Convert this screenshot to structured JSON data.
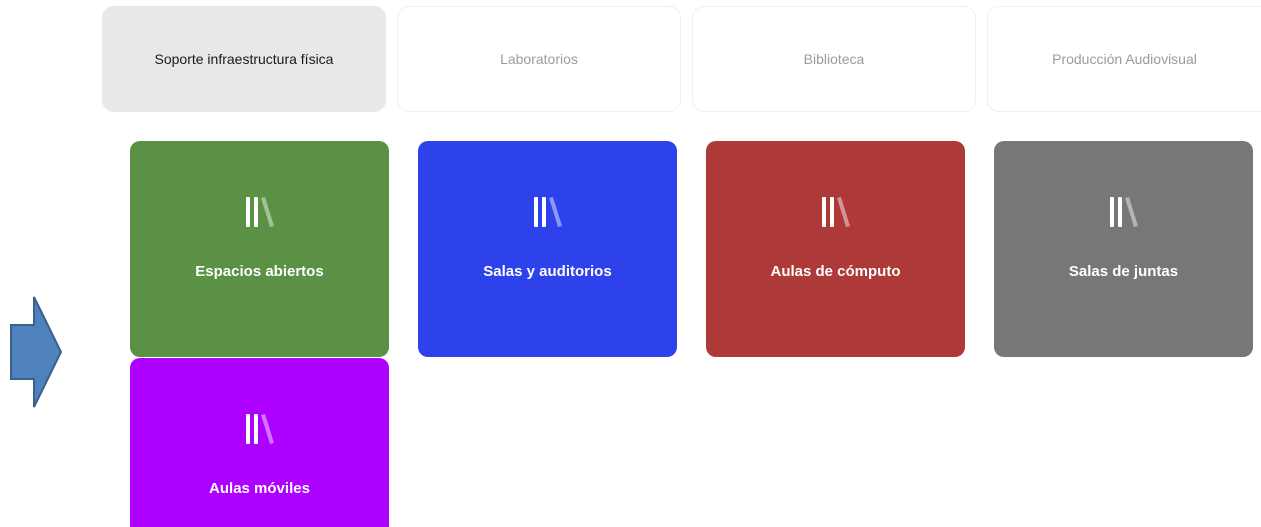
{
  "tabs": [
    {
      "label": "Soporte infraestructura física",
      "active": true
    },
    {
      "label": "Laboratorios",
      "active": false
    },
    {
      "label": "Biblioteca",
      "active": false
    },
    {
      "label": "Producción Audiovisual",
      "active": false
    }
  ],
  "arrow": {
    "icon": "right-arrow-icon",
    "color": "#4f81bd"
  },
  "cards": [
    {
      "label": "Espacios abiertos",
      "color": "#5a9144",
      "icon": "library-books-icon"
    },
    {
      "label": "Salas y auditorios",
      "color": "#2e42ec",
      "icon": "library-books-icon"
    },
    {
      "label": "Aulas de cómputo",
      "color": "#ad3939",
      "icon": "library-books-icon"
    },
    {
      "label": "Salas de juntas",
      "color": "#777777",
      "icon": "library-books-icon"
    },
    {
      "label": "Aulas móviles",
      "color": "#ad00ff",
      "icon": "library-books-icon"
    }
  ]
}
